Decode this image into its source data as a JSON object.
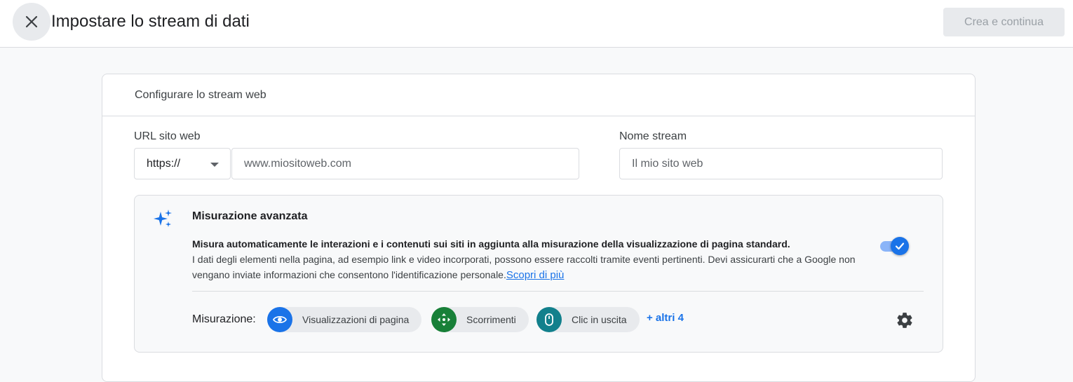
{
  "header": {
    "title": "Impostare lo stream di dati",
    "primary_button": "Crea e continua"
  },
  "card": {
    "title": "Configurare lo stream web",
    "url_label": "URL sito web",
    "protocol_value": "https://",
    "url_placeholder": "www.miositoweb.com",
    "stream_name_label": "Nome stream",
    "stream_name_placeholder": "Il mio sito web"
  },
  "enhanced_measurement": {
    "title": "Misurazione avanzata",
    "description_bold": "Misura automaticamente le interazioni e i contenuti sui siti in aggiunta alla misurazione della visualizzazione di pagina standard.",
    "description": "I dati degli elementi nella pagina, ad esempio link e video incorporati, possono essere raccolti tramite eventi pertinenti. Devi assicurarti che a Google non vengano inviate informazioni che consentono l'identificazione personale.",
    "learn_more": "Scopri di più",
    "enabled": true,
    "measurement_label": "Misurazione:",
    "chips": [
      {
        "label": "Visualizzazioni di pagina",
        "icon": "eye-icon",
        "color": "#1a73e8"
      },
      {
        "label": "Scorrimenti",
        "icon": "scroll-icon",
        "color": "#188038"
      },
      {
        "label": "Clic in uscita",
        "icon": "mouse-icon",
        "color": "#12808c"
      }
    ],
    "more": "+ altri 4"
  },
  "colors": {
    "accent": "#1a73e8",
    "border": "#dadce0",
    "background": "#f8f9fa"
  }
}
